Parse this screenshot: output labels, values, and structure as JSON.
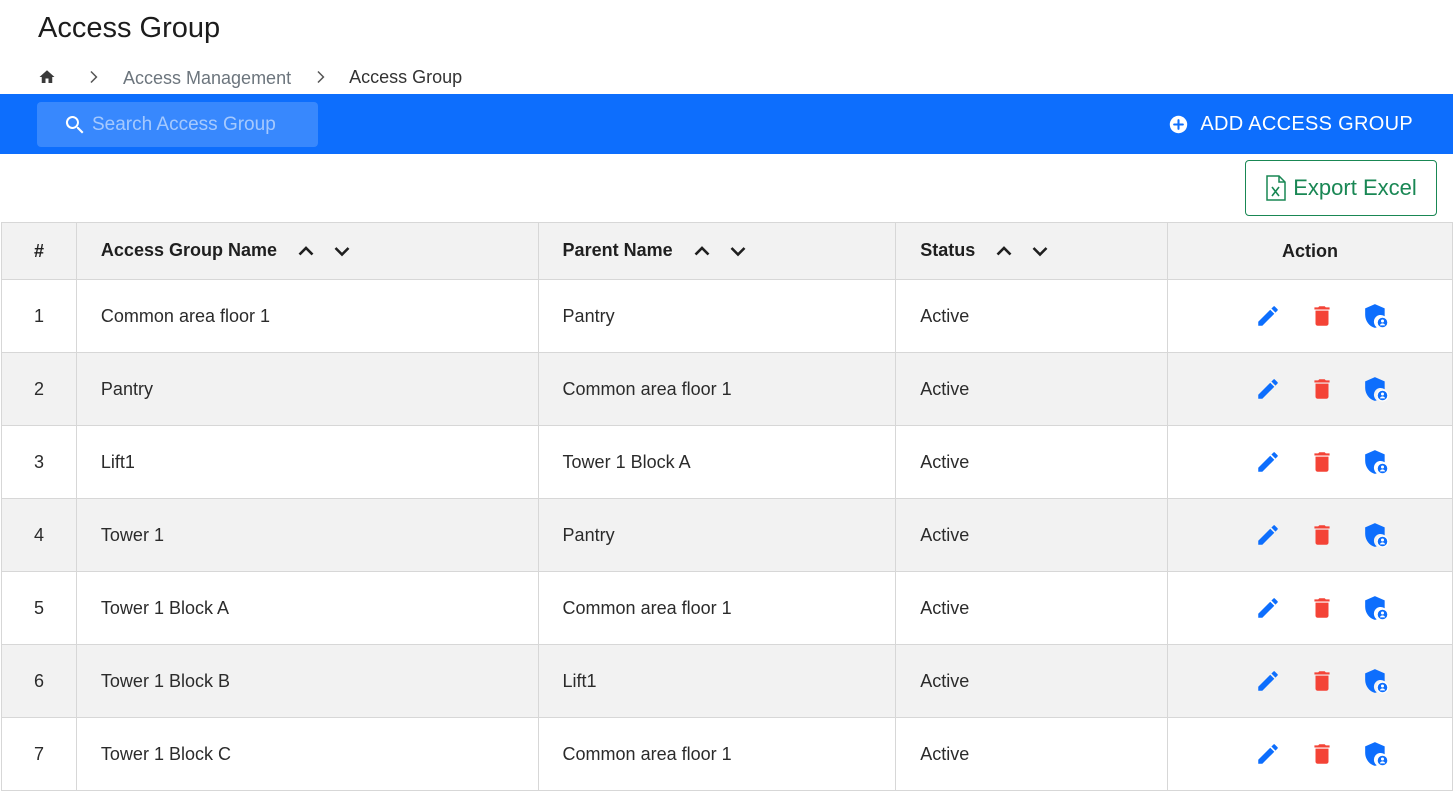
{
  "header": {
    "title": "Access Group"
  },
  "breadcrumb": {
    "home_icon": "home-icon",
    "items": [
      "Access Management",
      "Access Group"
    ]
  },
  "toolbar": {
    "search_placeholder": "Search Access Group",
    "add_label": "ADD ACCESS GROUP",
    "color": "#0d6efd"
  },
  "export": {
    "label": "Export Excel",
    "color": "#198754"
  },
  "table": {
    "columns": [
      "#",
      "Access Group Name",
      "Parent Name",
      "Status",
      "Action"
    ],
    "rows": [
      {
        "num": "1",
        "name": "Common area floor 1",
        "parent": "Pantry",
        "status": "Active"
      },
      {
        "num": "2",
        "name": "Pantry",
        "parent": "Common area floor 1",
        "status": "Active"
      },
      {
        "num": "3",
        "name": "Lift1",
        "parent": "Tower 1 Block A",
        "status": "Active"
      },
      {
        "num": "4",
        "name": "Tower 1",
        "parent": "Pantry",
        "status": "Active"
      },
      {
        "num": "5",
        "name": "Tower 1 Block A",
        "parent": "Common area floor 1",
        "status": "Active"
      },
      {
        "num": "6",
        "name": "Tower 1 Block B",
        "parent": "Lift1",
        "status": "Active"
      },
      {
        "num": "7",
        "name": "Tower 1 Block C",
        "parent": "Common area floor 1",
        "status": "Active"
      }
    ],
    "action_icons": [
      "edit-icon",
      "delete-icon",
      "shield-user-icon"
    ],
    "action_colors": {
      "edit": "#0d6efd",
      "delete": "#f44336",
      "permissions": "#0d6efd"
    }
  }
}
